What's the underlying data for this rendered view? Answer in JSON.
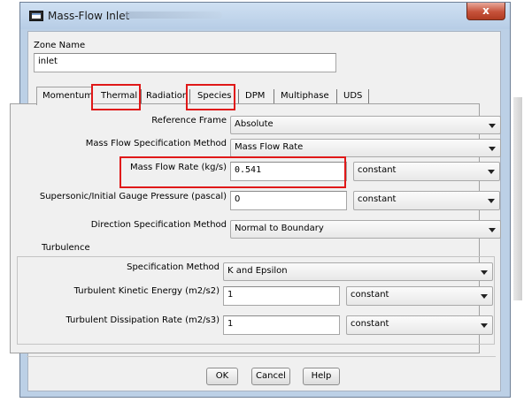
{
  "window": {
    "title": "Mass-Flow Inlet",
    "close_glyph": "x"
  },
  "zone": {
    "label": "Zone Name",
    "value": "inlet"
  },
  "tabs": [
    "Momentum",
    "Thermal",
    "Radiation",
    "Species",
    "DPM",
    "Multiphase",
    "UDS"
  ],
  "form": {
    "reference_frame": {
      "label": "Reference Frame",
      "value": "Absolute"
    },
    "mass_flow_method": {
      "label": "Mass Flow Specification Method",
      "value": "Mass Flow Rate"
    },
    "mass_flow_rate": {
      "label": "Mass Flow Rate (kg/s)",
      "value": "0.541",
      "mode": "constant"
    },
    "gauge_pressure": {
      "label": "Supersonic/Initial Gauge Pressure (pascal)",
      "value": "0",
      "mode": "constant"
    },
    "direction_method": {
      "label": "Direction Specification Method",
      "value": "Normal to Boundary"
    }
  },
  "turbulence": {
    "title": "Turbulence",
    "spec_method": {
      "label": "Specification Method",
      "value": "K and Epsilon"
    },
    "kinetic_energy": {
      "label": "Turbulent Kinetic Energy (m2/s2)",
      "value": "1",
      "mode": "constant"
    },
    "dissipation_rate": {
      "label": "Turbulent Dissipation Rate (m2/s3)",
      "value": "1",
      "mode": "constant"
    }
  },
  "buttons": {
    "ok": "OK",
    "cancel": "Cancel",
    "help": "Help"
  },
  "colors": {
    "highlight": "#e01818",
    "title_bar": "#bcd0e6",
    "close_button": "#c6523a"
  },
  "icons": {
    "app": "window-icon",
    "close": "close-icon",
    "dropdown": "chevron-down-icon"
  }
}
